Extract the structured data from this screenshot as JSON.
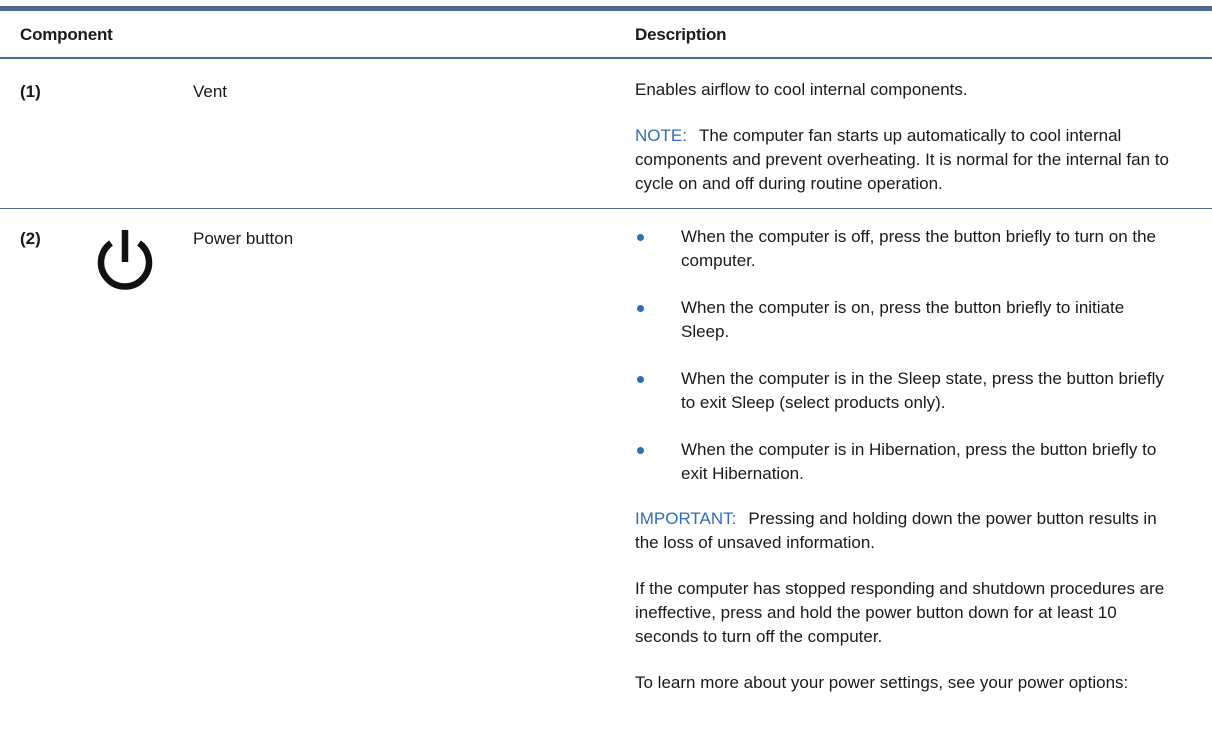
{
  "table": {
    "headers": {
      "component": "Component",
      "description": "Description"
    },
    "rows": [
      {
        "number": "(1)",
        "name": "Vent",
        "description": "Enables airflow to cool internal components.",
        "note": {
          "label": "NOTE:",
          "text": "The computer fan starts up automatically to cool internal components and prevent overheating. It is normal for the internal fan to cycle on and off during routine operation."
        }
      },
      {
        "number": "(2)",
        "icon": "power-icon",
        "name": "Power button",
        "bullets": [
          "When the computer is off, press the button briefly to turn on the computer.",
          "When the computer is on, press the button briefly to initiate Sleep.",
          "When the computer is in the Sleep state, press the button briefly to exit Sleep (select products only).",
          "When the computer is in Hibernation, press the button briefly to exit Hibernation."
        ],
        "important": {
          "label": "IMPORTANT:",
          "text": "Pressing and holding down the power button results in the loss of unsaved information."
        },
        "paragraphs": [
          "If the computer has stopped responding and shutdown procedures are ineffective, press and hold the power button down for at least 10 seconds to turn off the computer.",
          "To learn more about your power settings, see your power options:"
        ]
      }
    ]
  },
  "colors": {
    "rule": "#4f6b8f",
    "accent": "#2f6db5",
    "text": "#1a1a1a"
  }
}
